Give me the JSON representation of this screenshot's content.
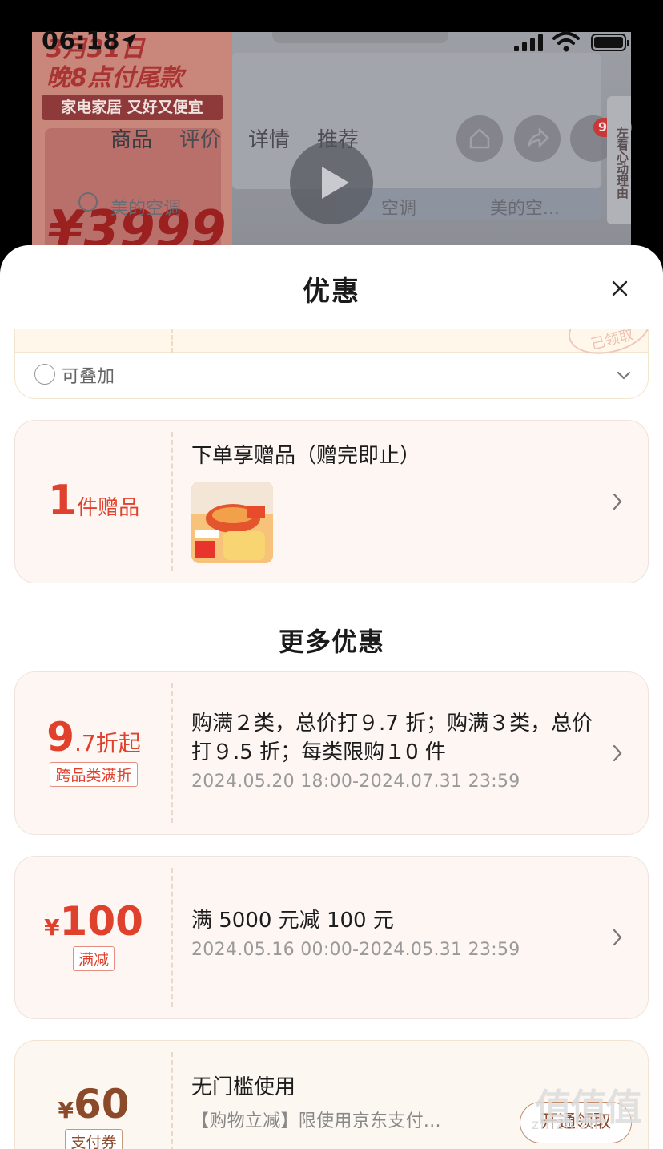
{
  "status_bar": {
    "time": "06:18"
  },
  "background_page": {
    "promo_line1": "3月31日",
    "promo_line2": "晚8点付尾款",
    "promo_banner": "家电家居 又好又便宜",
    "promo_price": "¥3999",
    "nav_tabs": [
      "商品",
      "评价",
      "详情",
      "推荐"
    ],
    "cart_badge": "99+",
    "side_tab": "左看心动理由",
    "sub_items": [
      "美的空调",
      "空调",
      "美的空..."
    ]
  },
  "sheet": {
    "title": "优惠",
    "stacked_strip_stamp": "已领取",
    "stackable_label": "可叠加",
    "gift_card": {
      "count": "1",
      "unit": "件赠品",
      "text": "下单享赠品（赠完即止）"
    },
    "more_title": "更多优惠",
    "promotions": [
      {
        "amount_big": "9",
        "amount_small": ".7折起",
        "tag": "跨品类满折",
        "text": "购满２类，总价打９.7 折；购满３类，总价打９.5 折；每类限购１0 件",
        "date": "2024.05.20 18:00-2024.07.31 23:59"
      },
      {
        "currency": "¥",
        "amount_big": "100",
        "tag": "满减",
        "text": "满 5000 元减 100 元",
        "date": "2024.05.16 00:00-2024.05.31 23:59"
      },
      {
        "currency": "¥",
        "amount_big": "60",
        "tag": "支付券",
        "text": "无门槛使用",
        "sub_text": "【购物立减】限使用京东支付...",
        "button": "开通领取"
      }
    ]
  },
  "watermark": {
    "main": "值值值",
    "sub": "zhizhizhi"
  },
  "colors": {
    "accent_red": "#e0412c",
    "card_bg": "#fdf6f3"
  }
}
